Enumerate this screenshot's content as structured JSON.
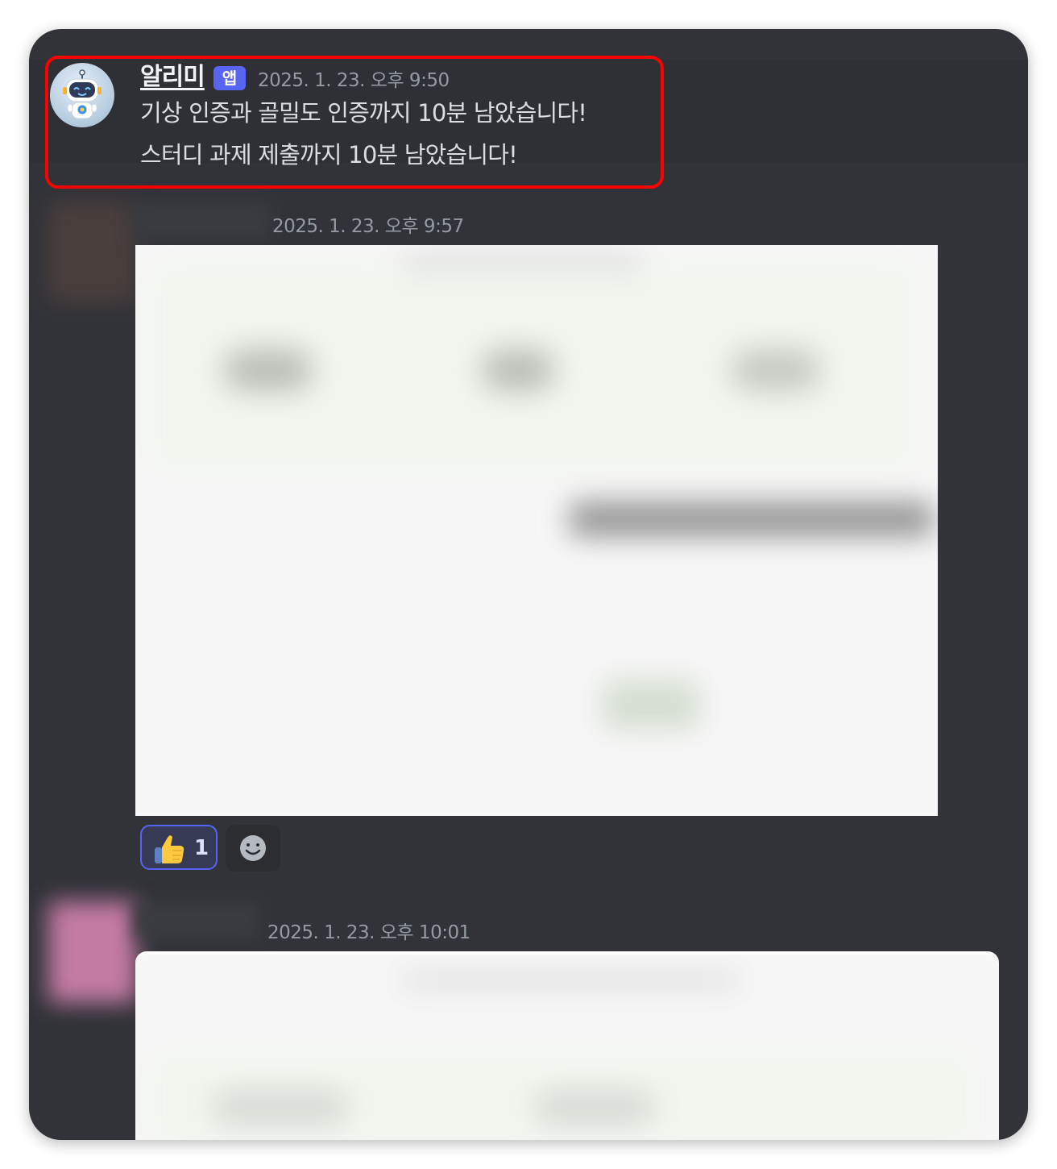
{
  "messages": [
    {
      "author": "알리미",
      "badge": "앱",
      "timestamp": "2025. 1. 23. 오후 9:50",
      "lines": [
        "기상 인증과 골밀도 인증까지 10분 남았습니다!",
        "스터디 과제 제출까지 10분 남았습니다!"
      ]
    },
    {
      "timestamp": "2025. 1. 23. 오후 9:57",
      "reactions": [
        {
          "emoji": "thumbs-up-icon",
          "count": "1"
        }
      ]
    },
    {
      "timestamp": "2025. 1. 23. 오후 10:01"
    }
  ],
  "colors": {
    "background": "#313338",
    "highlight_border": "#ff0000",
    "badge": "#5865f2",
    "timestamp": "#949ba4"
  }
}
